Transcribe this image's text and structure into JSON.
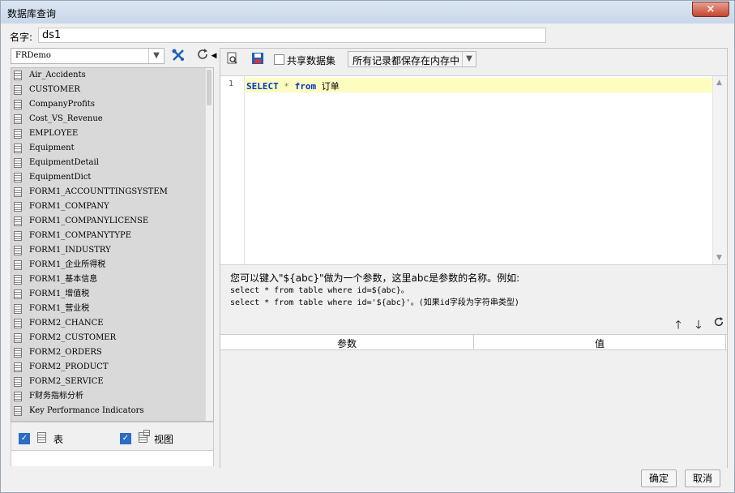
{
  "window": {
    "title": "数据库查询",
    "close_icon": "×"
  },
  "name_field": {
    "label": "名字:",
    "value": "ds1"
  },
  "left": {
    "database": "FRDemo",
    "tables": [
      "Air_Accidents",
      "CUSTOMER",
      "CompanyProfits",
      "Cost_VS_Revenue",
      "EMPLOYEE",
      "Equipment",
      "EquipmentDetail",
      "EquipmentDict",
      "FORM1_ACCOUNTTINGSYSTEM",
      "FORM1_COMPANY",
      "FORM1_COMPANYLICENSE",
      "FORM1_COMPANYTYPE",
      "FORM1_INDUSTRY",
      "FORM1_企业所得税",
      "FORM1_基本信息",
      "FORM1_增值税",
      "FORM1_营业税",
      "FORM2_CHANCE",
      "FORM2_CUSTOMER",
      "FORM2_ORDERS",
      "FORM2_PRODUCT",
      "FORM2_SERVICE",
      "F财务指标分析",
      "Key Performance Indicators"
    ],
    "show_tables_label": "表",
    "show_views_label": "视图"
  },
  "toolbar": {
    "share_label": "共享数据集",
    "memory_option": "所有记录都保存在内存中"
  },
  "editor": {
    "line_number": "1",
    "kw_select": "SELECT",
    "star": "*",
    "kw_from": "from",
    "table_name": "订单"
  },
  "hint": {
    "line1": "您可以键入\"${abc}\"做为一个参数，这里abc是参数的名称。例如:",
    "line2": "select * from table where id=${abc}。",
    "line3": "select * from table where id='${abc}'。(如果id字段为字符串类型)"
  },
  "params": {
    "col_param": "参数",
    "col_value": "值"
  },
  "buttons": {
    "ok": "确定",
    "cancel": "取消"
  }
}
